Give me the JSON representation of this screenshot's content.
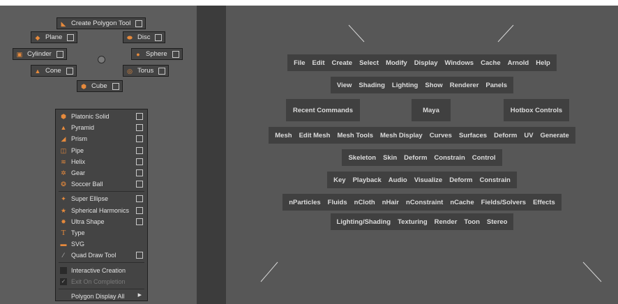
{
  "marking_menu": {
    "north": {
      "label": "Create Polygon Tool",
      "icon": "polygon-tool-icon"
    },
    "northwest": {
      "label": "Plane",
      "icon": "plane-icon"
    },
    "northeast": {
      "label": "Disc",
      "icon": "disc-icon"
    },
    "west": {
      "label": "Cylinder",
      "icon": "cylinder-icon"
    },
    "east": {
      "label": "Sphere",
      "icon": "sphere-icon"
    },
    "southwest": {
      "label": "Cone",
      "icon": "cone-icon"
    },
    "southeast": {
      "label": "Torus",
      "icon": "torus-icon"
    },
    "south": {
      "label": "Cube",
      "icon": "cube-icon"
    }
  },
  "overflow_menu": {
    "items": [
      {
        "label": "Platonic Solid",
        "icon": "platonic-solid-icon",
        "option_box": true
      },
      {
        "label": "Pyramid",
        "icon": "pyramid-icon",
        "option_box": true
      },
      {
        "label": "Prism",
        "icon": "prism-icon",
        "option_box": true
      },
      {
        "label": "Pipe",
        "icon": "pipe-icon",
        "option_box": true
      },
      {
        "label": "Helix",
        "icon": "helix-icon",
        "option_box": true
      },
      {
        "label": "Gear",
        "icon": "gear-icon",
        "option_box": true
      },
      {
        "label": "Soccer Ball",
        "icon": "soccer-ball-icon",
        "option_box": true
      },
      {
        "label": "Super Ellipse",
        "icon": "super-ellipse-icon",
        "option_box": true
      },
      {
        "label": "Spherical Harmonics",
        "icon": "spherical-harmonics-icon",
        "option_box": true
      },
      {
        "label": "Ultra Shape",
        "icon": "ultra-shape-icon",
        "option_box": true
      },
      {
        "label": "Type",
        "icon": "type-icon",
        "option_box": false
      },
      {
        "label": "SVG",
        "icon": "svg-icon",
        "option_box": false
      },
      {
        "label": "Quad Draw Tool",
        "icon": "quad-draw-icon",
        "option_box": true
      },
      {
        "label": "Interactive Creation",
        "checked": false
      },
      {
        "label": "Exit On Completion",
        "checked": true,
        "disabled": true
      },
      {
        "label": "Polygon Display All",
        "submenu": true
      }
    ]
  },
  "hotbox": {
    "row1": [
      "File",
      "Edit",
      "Create",
      "Select",
      "Modify",
      "Display",
      "Windows",
      "Cache",
      "Arnold",
      "Help"
    ],
    "row2": [
      "View",
      "Shading",
      "Lighting",
      "Show",
      "Renderer",
      "Panels"
    ],
    "row3": {
      "left": "Recent Commands",
      "center": "Maya",
      "right": "Hotbox Controls"
    },
    "row4": [
      "Mesh",
      "Edit Mesh",
      "Mesh Tools",
      "Mesh Display",
      "Curves",
      "Surfaces",
      "Deform",
      "UV",
      "Generate"
    ],
    "row5": [
      "Skeleton",
      "Skin",
      "Deform",
      "Constrain",
      "Control"
    ],
    "row6": [
      "Key",
      "Playback",
      "Audio",
      "Visualize",
      "Deform",
      "Constrain"
    ],
    "row7": [
      "nParticles",
      "Fluids",
      "nCloth",
      "nHair",
      "nConstraint",
      "nCache",
      "Fields/Solvers",
      "Effects"
    ],
    "row8": [
      "Lighting/Shading",
      "Texturing",
      "Render",
      "Toon",
      "Stereo"
    ]
  },
  "colors": {
    "icon_accent": "#e68a3c",
    "panel_bg": "#5d5d5d",
    "hotbox_bg": "#575757",
    "item_bg": "#404040"
  }
}
